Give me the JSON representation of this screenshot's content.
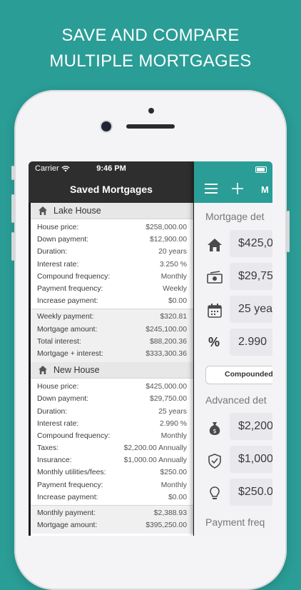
{
  "headline": {
    "line1": "SAVE AND COMPARE",
    "line2": "MULTIPLE MORTGAGES"
  },
  "status_bar": {
    "carrier": "Carrier",
    "time": "9:46 PM"
  },
  "left_panel": {
    "title": "Saved Mortgages",
    "mortgages": [
      {
        "name": "Lake House",
        "details": [
          {
            "label": "House price:",
            "value": "$258,000.00"
          },
          {
            "label": "Down payment:",
            "value": "$12,900.00"
          },
          {
            "label": "Duration:",
            "value": "20 years"
          },
          {
            "label": "Interest rate:",
            "value": "3.250 %"
          },
          {
            "label": "Compound frequency:",
            "value": "Monthly"
          },
          {
            "label": "Payment frequency:",
            "value": "Weekly"
          },
          {
            "label": "Increase payment:",
            "value": "$0.00"
          }
        ],
        "totals": [
          {
            "label": "Weekly payment:",
            "value": "$320.81"
          },
          {
            "label": "Mortgage amount:",
            "value": "$245,100.00"
          },
          {
            "label": "Total interest:",
            "value": "$88,200.36"
          },
          {
            "label": "Mortgage + interest:",
            "value": "$333,300.36"
          }
        ]
      },
      {
        "name": "New House",
        "details": [
          {
            "label": "House price:",
            "value": "$425,000.00"
          },
          {
            "label": "Down payment:",
            "value": "$29,750.00"
          },
          {
            "label": "Duration:",
            "value": "25 years"
          },
          {
            "label": "Interest rate:",
            "value": "2.990 %"
          },
          {
            "label": "Compound frequency:",
            "value": "Monthly"
          },
          {
            "label": "Taxes:",
            "value": "$2,200.00 Annually"
          },
          {
            "label": "Insurance:",
            "value": "$1,000.00 Annually"
          },
          {
            "label": "Monthly utilities/fees:",
            "value": "$250.00"
          },
          {
            "label": "Payment frequency:",
            "value": "Monthly"
          },
          {
            "label": "Increase payment:",
            "value": "$0.00"
          }
        ],
        "totals": [
          {
            "label": "Monthly payment:",
            "value": "$2,388.93"
          },
          {
            "label": "Mortgage amount:",
            "value": "$395,250.00"
          }
        ]
      }
    ]
  },
  "right_panel": {
    "nav_title": "M",
    "mortgage_section": "Mortgage det",
    "fields": {
      "house_price": "$425,0",
      "down_payment": "$29,75",
      "duration": "25 yea",
      "interest_rate": "2.990"
    },
    "percent_symbol": "%",
    "compounded_label": "Compounded",
    "advanced_section": "Advanced det",
    "advanced_fields": {
      "taxes": "$2,200",
      "insurance": "$1,000",
      "utilities": "$250.0"
    },
    "payment_section": "Payment freq"
  },
  "colors": {
    "brand": "#2a9d96",
    "nav_dark": "#2e2e2e",
    "section_bg": "#e7e7e7",
    "totals_bg": "#f0f0f0"
  }
}
